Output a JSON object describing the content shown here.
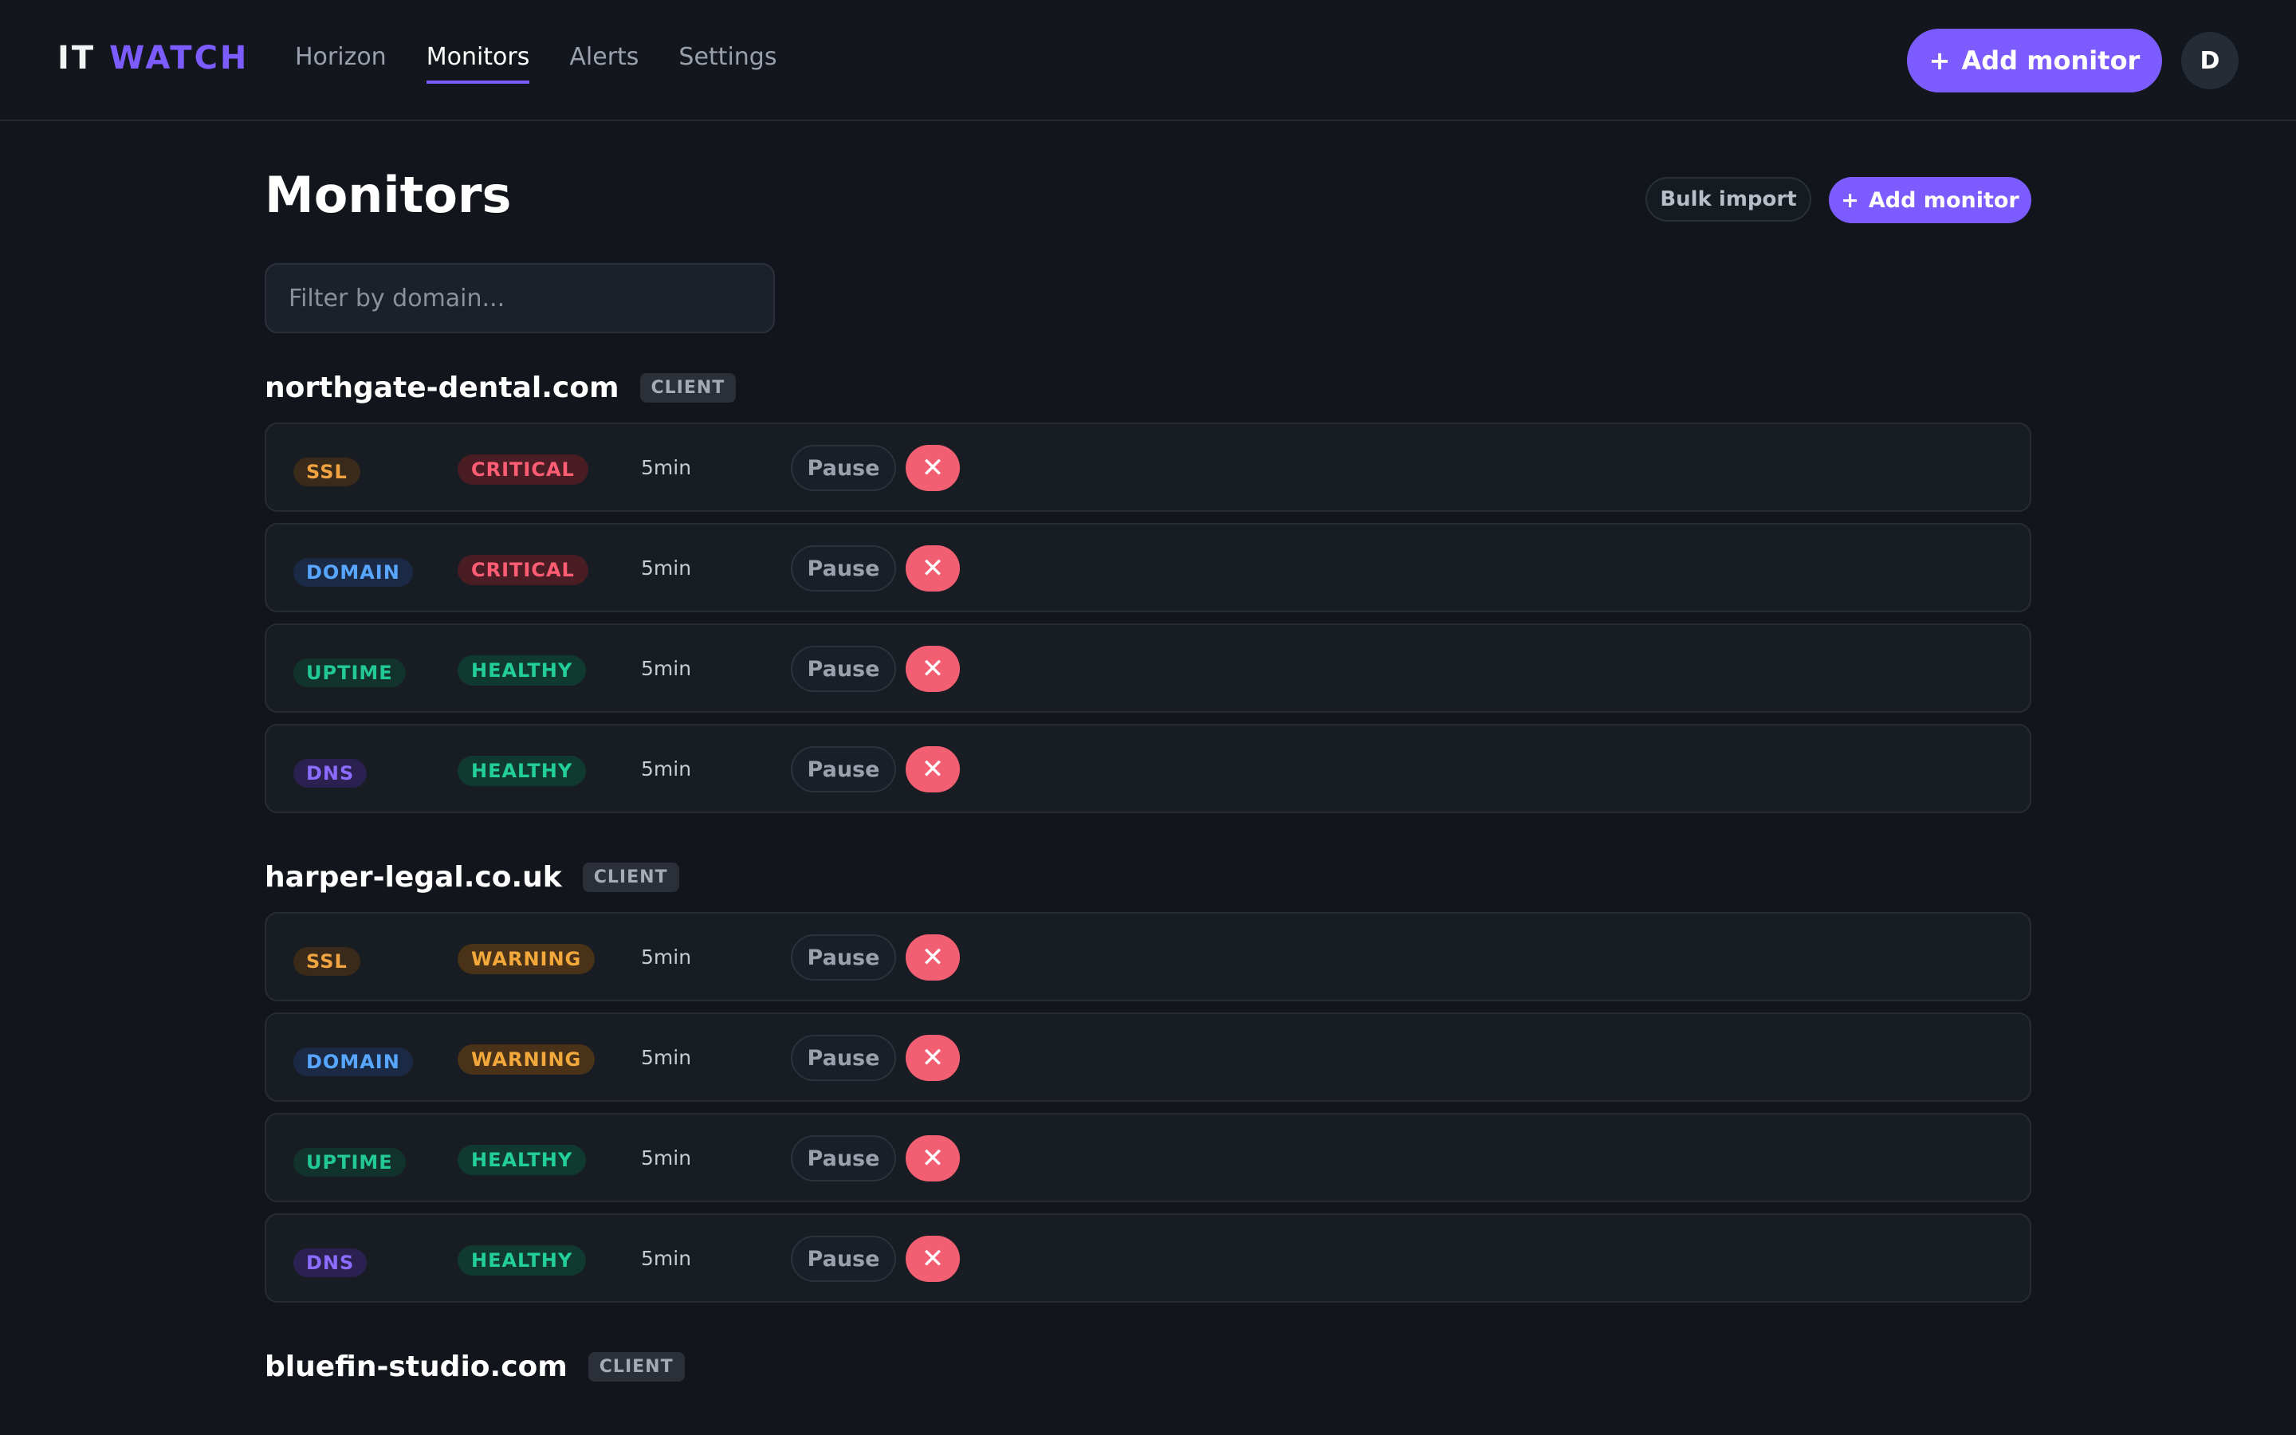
{
  "app": {
    "logo_part1": "IT",
    "logo_part2": "WATCH"
  },
  "nav": {
    "items": [
      "Horizon",
      "Monitors",
      "Alerts",
      "Settings"
    ],
    "active": "Monitors"
  },
  "header": {
    "add_monitor_label": "Add monitor",
    "avatar_initial": "D"
  },
  "page": {
    "title": "Monitors",
    "bulk_import_label": "Bulk import",
    "add_monitor_label": "Add monitor",
    "filter_placeholder": "Filter by domain..."
  },
  "colors": {
    "accent": "#7c5cff",
    "critical": "#ff5d73",
    "warning": "#f3a83b",
    "healthy": "#23cf98",
    "remove": "#f25f72"
  },
  "icons": {
    "plus": "plus-icon",
    "remove": "close-icon"
  },
  "actions": {
    "pause_label": "Pause",
    "remove_glyph": "✕"
  },
  "groups": [
    {
      "domain": "northgate-dental.com",
      "badge": "CLIENT",
      "monitors": [
        {
          "type": "SSL",
          "status": "CRITICAL",
          "interval": "5min"
        },
        {
          "type": "DOMAIN",
          "status": "CRITICAL",
          "interval": "5min"
        },
        {
          "type": "UPTIME",
          "status": "HEALTHY",
          "interval": "5min"
        },
        {
          "type": "DNS",
          "status": "HEALTHY",
          "interval": "5min"
        }
      ]
    },
    {
      "domain": "harper-legal.co.uk",
      "badge": "CLIENT",
      "monitors": [
        {
          "type": "SSL",
          "status": "WARNING",
          "interval": "5min"
        },
        {
          "type": "DOMAIN",
          "status": "WARNING",
          "interval": "5min"
        },
        {
          "type": "UPTIME",
          "status": "HEALTHY",
          "interval": "5min"
        },
        {
          "type": "DNS",
          "status": "HEALTHY",
          "interval": "5min"
        }
      ]
    },
    {
      "domain": "bluefin-studio.com",
      "badge": "CLIENT",
      "monitors": []
    }
  ]
}
